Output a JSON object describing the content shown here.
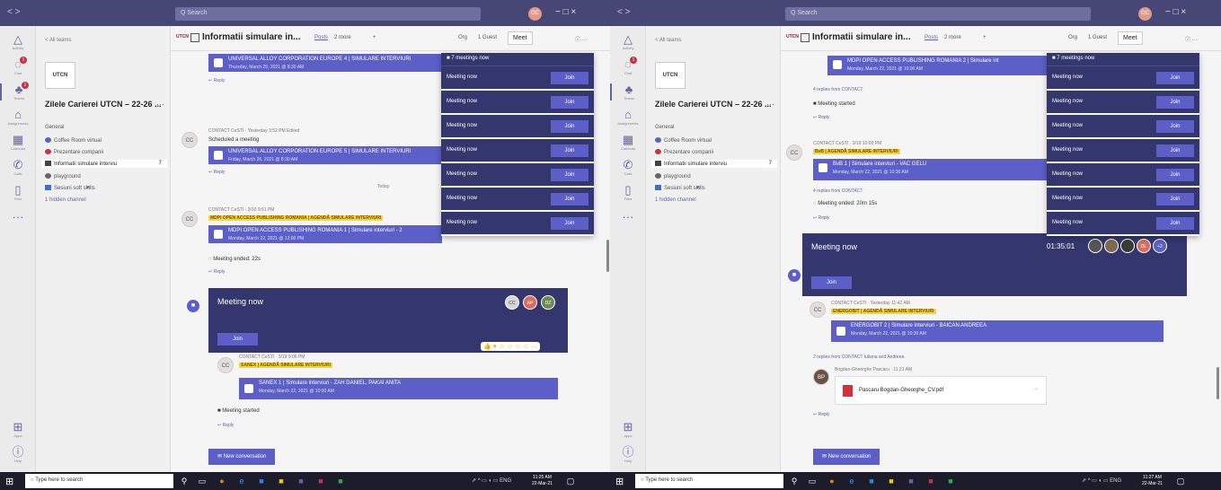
{
  "titlebar": {
    "nav": "< >",
    "search_placeholder": "Q Search",
    "avatar": "OC",
    "controls": "− □ ×"
  },
  "rail": [
    {
      "icon": "bell",
      "label": "Activity",
      "glyph": "△"
    },
    {
      "icon": "chat",
      "label": "Chat",
      "glyph": "◌",
      "badge": "1"
    },
    {
      "icon": "teams",
      "label": "Teams",
      "glyph": "♣",
      "badge": "1"
    },
    {
      "icon": "assignments",
      "label": "Assignments",
      "glyph": "⌂"
    },
    {
      "icon": "calendar",
      "label": "Calendar",
      "glyph": "▦"
    },
    {
      "icon": "calls",
      "label": "Calls",
      "glyph": "✆"
    },
    {
      "icon": "files",
      "label": "Files",
      "glyph": "▯"
    },
    {
      "icon": "more",
      "label": "",
      "glyph": "···"
    }
  ],
  "rail_bottom": [
    {
      "icon": "apps",
      "label": "Apps",
      "glyph": "⊞"
    },
    {
      "icon": "help",
      "label": "Help",
      "glyph": "ⓘ"
    }
  ],
  "sidebar": {
    "all_teams": "< All teams",
    "logo": "UTCN",
    "team_name": "Zilele Carierei UTCN – 22-26 ...",
    "more": "···",
    "channels": [
      {
        "label": "General"
      },
      {
        "label": "Coffee Room virtual",
        "color": "#5b5fc7"
      },
      {
        "label": "Prezentare companii",
        "color": "#c4314b"
      },
      {
        "label": "Informatii simulare interviu",
        "color": "#444",
        "selected": true,
        "badge": "7"
      },
      {
        "label": "playground",
        "color": "#666"
      },
      {
        "label": "Sesiuni soft skills",
        "color": "#3b6fd4",
        "dot": true
      },
      {
        "label": "1 hidden channel"
      }
    ]
  },
  "header": {
    "title": "Informatii simulare in...",
    "posts": "Posts",
    "more": "2 more",
    "add": "+",
    "org": "Org",
    "guest": "1 Guest",
    "meet": "Meet",
    "info": "ⓘ ···"
  },
  "left_feed": {
    "card1": {
      "t1": "UNIVERSAL ALLOY CORPORATION EUROPE 4 | SIMULARE INTERVIURI",
      "t2": "Thursday, March 25, 2021 @ 8:30 AM"
    },
    "reply": "↩ Reply",
    "post1": {
      "author": "CONTACT CeSTI",
      "time": "Yesterday 3:52 PM  Edited",
      "text": "Scheduled a meeting"
    },
    "card2": {
      "t1": "UNIVERSAL ALLOY CORPORATION EUROPE 5 | SIMULARE INTERVIURI",
      "t2": "Friday, March 26, 2021 @ 8:30 AM"
    },
    "today": "Today",
    "post2": {
      "author": "CONTACT CeSTI",
      "time": "3/10 9:51 PM",
      "hl": "MDPI OPEN ACCESS PUBLISHING ROMANIA | AGENDĂ SIMULARE INTERVIURI"
    },
    "card3": {
      "t1": "MDPI OPEN ACCESS PUBLISHING ROMANIA 1 | Simulare interviuri - 2",
      "t2": "Monday, March 22, 2021 @ 12:00 PM"
    },
    "ended": "Meeting ended: 22s",
    "meeting": {
      "title": "Meeting now",
      "join": "Join",
      "p1": "CC",
      "p2": "AP",
      "p3": "DZ"
    },
    "post3": {
      "author": "CONTACT CeSTI",
      "time": "3/19 9:06 PM",
      "hl": "SANEX | AGENDĂ SIMULARE INTERVIURI"
    },
    "card4": {
      "t1": "SANEX 1 | Simulare interviuri - ZAH DANIEL, PAKAI ANITA",
      "t2": "Monday, March 22, 2021 @ 10:00 AM"
    },
    "started": "Meeting started",
    "newconv": "New conversation"
  },
  "popup": {
    "header": "7 meetings now",
    "row_label": "Meeting now",
    "join": "Join"
  },
  "right_feed": {
    "card0": {
      "t1": "MDPI OPEN ACCESS PUBLISHING ROMANIA 2 | Simulare int",
      "t2": "Monday, March 22, 2021 @ 10:00 AM"
    },
    "replies1": "4 replies from CONTACT",
    "started": "Meeting started",
    "reply": "↩ Reply",
    "post1": {
      "author": "CONTACT CeSTI",
      "time": "3/19 10:00 PM",
      "hl": "BvB | AGENDĂ SIMULARE INTERVIURI"
    },
    "card1": {
      "t1": "BvB 1 | Simulare interviuri - VAC GELU",
      "t2": "Monday, March 22, 2021 @ 10:30 AM"
    },
    "replies2": "4 replies from CONTACT",
    "ended": "Meeting ended: 20m 15s",
    "meeting": {
      "title": "Meeting now",
      "timer": "01:35:01",
      "join": "Join",
      "extra": "+2",
      "p3": "DL"
    },
    "post2": {
      "author": "CONTACT CeSTI",
      "time": "Yesterday 11:42 AM",
      "hl": "ENERGOBIT | AGENDĂ SIMULARE INTERVIURI"
    },
    "card2": {
      "t1": "ENERGOBIT 2 | Simulare interviuri - BAICAN ANDREEA",
      "t2": "Monday, March 22, 2021 @ 10:30 AM"
    },
    "replies3": "2 replies from CONTACT Iuliana and Andreea",
    "post3": {
      "author": "Bogdan-Gheorghe Pascaru",
      "time": "11:21 AM"
    },
    "file": "Pascaru Bogdan-Gheorghe_CV.pdf",
    "newconv": "New conversation"
  },
  "taskbar": {
    "search": "Type here to search",
    "sys": "ENG",
    "clock_left": "11:25 AM",
    "clock_right": "11:27 AM",
    "date": "22-Mar-21"
  }
}
